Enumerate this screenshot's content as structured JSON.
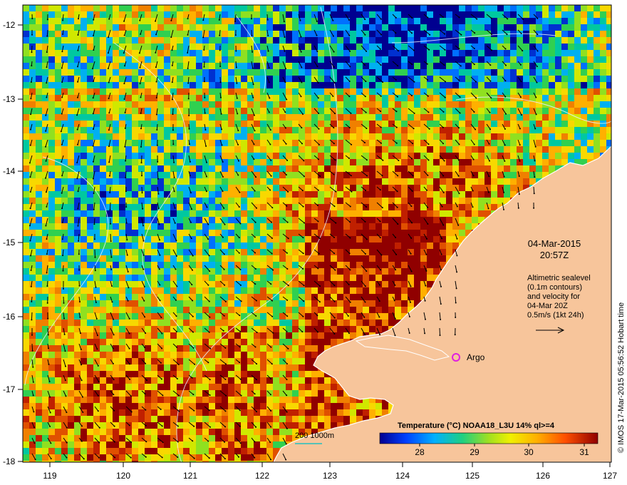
{
  "map": {
    "lat_ticks": [
      "-12",
      "-13",
      "-14",
      "-15",
      "-16",
      "-17",
      "-18"
    ],
    "lon_ticks": [
      "119",
      "120",
      "121",
      "122",
      "123",
      "124",
      "125",
      "126",
      "127"
    ],
    "date_line1": "04-Mar-2015",
    "date_line2": "20:57Z",
    "altimetry_lines": [
      "Altimetric sealevel",
      "(0.1m contours)",
      "and velocity for",
      "04-Mar 20Z",
      "0.5m/s (1kt 24h)"
    ],
    "argo_label": "Argo",
    "scale_label": "200  1000m",
    "credit": "© IMOS 17-Mar-2015 05:56:52 Hobart time",
    "colorbar_title": "Temperature (°C) NOAA18_L3U 14% ql>=4",
    "colorbar_ticks": [
      "28",
      "29",
      "30",
      "31"
    ],
    "colors": {
      "land": "#f7c59b",
      "coast": "#ffffff",
      "argo": "#e020e0",
      "frame": "#000000"
    }
  }
}
